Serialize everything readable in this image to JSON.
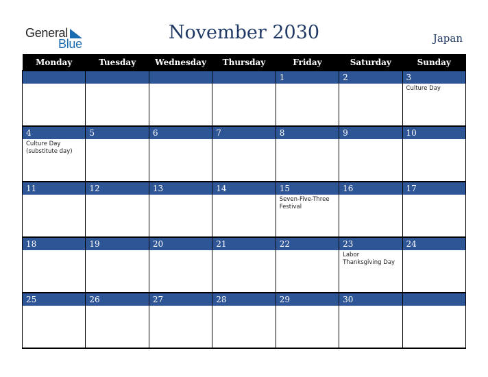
{
  "logo": {
    "line1": "General",
    "line2": "Blue"
  },
  "title": "November 2030",
  "country": "Japan",
  "colors": {
    "header_bg": "#000000",
    "band_bg": "#2e5596",
    "title": "#1f3864",
    "logo_blue": "#1a6bb0"
  },
  "weekdays": [
    "Monday",
    "Tuesday",
    "Wednesday",
    "Thursday",
    "Friday",
    "Saturday",
    "Sunday"
  ],
  "weeks": [
    {
      "days": [
        "",
        "",
        "",
        "",
        "1",
        "2",
        "3"
      ],
      "events": [
        "",
        "",
        "",
        "",
        "",
        "",
        "Culture Day"
      ]
    },
    {
      "days": [
        "4",
        "5",
        "6",
        "7",
        "8",
        "9",
        "10"
      ],
      "events": [
        "Culture Day (substitute day)",
        "",
        "",
        "",
        "",
        "",
        ""
      ]
    },
    {
      "days": [
        "11",
        "12",
        "13",
        "14",
        "15",
        "16",
        "17"
      ],
      "events": [
        "",
        "",
        "",
        "",
        "Seven-Five-Three Festival",
        "",
        ""
      ]
    },
    {
      "days": [
        "18",
        "19",
        "20",
        "21",
        "22",
        "23",
        "24"
      ],
      "events": [
        "",
        "",
        "",
        "",
        "",
        "Labor Thanksgiving Day",
        ""
      ]
    },
    {
      "days": [
        "25",
        "26",
        "27",
        "28",
        "29",
        "30",
        ""
      ],
      "events": [
        "",
        "",
        "",
        "",
        "",
        "",
        ""
      ]
    }
  ]
}
